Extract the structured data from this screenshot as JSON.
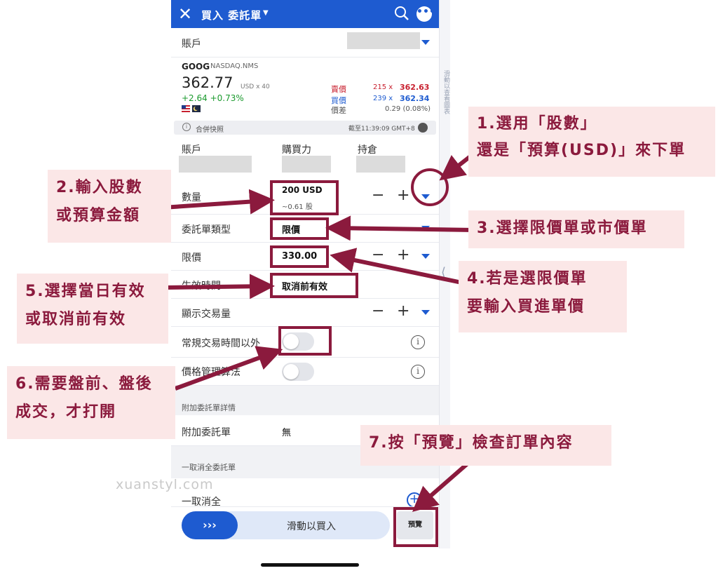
{
  "header": {
    "title": "買入 委託單",
    "close_icon": "close-icon",
    "search_icon": "search-icon",
    "more_icon": "more-icon"
  },
  "account_row": {
    "label": "賬戶"
  },
  "stock": {
    "symbol": "GOOG",
    "exchange": "NASDAQ.NMS",
    "price": "362.77",
    "currency_lot": "USD x 40",
    "change": "+2.64 +0.73%",
    "ask_label": "賣價",
    "ask_size": "215 x",
    "ask_price": "362.63",
    "bid_label": "買價",
    "bid_size": "239 x",
    "bid_price": "362.34",
    "spread_label": "價差",
    "spread_value": "0.29 (0.08%)"
  },
  "info_bar": {
    "text": "合併快照",
    "time": "截至11:39:09 GMT+8"
  },
  "summary": {
    "account": "賬戶",
    "buying_power": "購買力",
    "position": "持倉"
  },
  "form": {
    "quantity_label": "數量",
    "quantity_value": "200 USD",
    "quantity_sub": "~0.61 股",
    "order_type_label": "委託單類型",
    "order_type_value": "限價",
    "limit_label": "限價",
    "limit_value": "330.00",
    "tif_label": "生效時間",
    "tif_value": "取消前有效",
    "display_label": "顯示交易量",
    "outside_rth_label": "常規交易時間以外",
    "algo_label": "價格管理算法"
  },
  "attached_section": {
    "title": "附加委託單詳情",
    "label": "附加委託單",
    "value": "無"
  },
  "oca_section": {
    "title": "一取消全委託單",
    "label": "一取消全"
  },
  "bottom": {
    "slide_label": "滑動以買入",
    "slide_arrows": "›››",
    "preview_label": "預覽"
  },
  "side_panel": {
    "text": "滑動以查看圖表"
  },
  "watermark": "xuanstyl.com",
  "annotations": {
    "a1": "1.選用「股數」\n還是「預算(USD)」來下單",
    "a2": "2.輸入股數\n或預算金額",
    "a3": "3.選擇限價單或市價單",
    "a4": "4.若是選限價單\n要輸入買進單價",
    "a5": "5.選擇當日有效\n或取消前有效",
    "a6": "6.需要盤前、盤後\n成交，才打開",
    "a7": "7.按「預覽」檢查訂單內容"
  },
  "colors": {
    "brand": "#1e5bd0",
    "annotation": "#8b1a3d",
    "annotation_bg": "#fbe7e7",
    "up": "#1b9a2e",
    "ask": "#c8202f",
    "bid": "#1e5bd0"
  }
}
